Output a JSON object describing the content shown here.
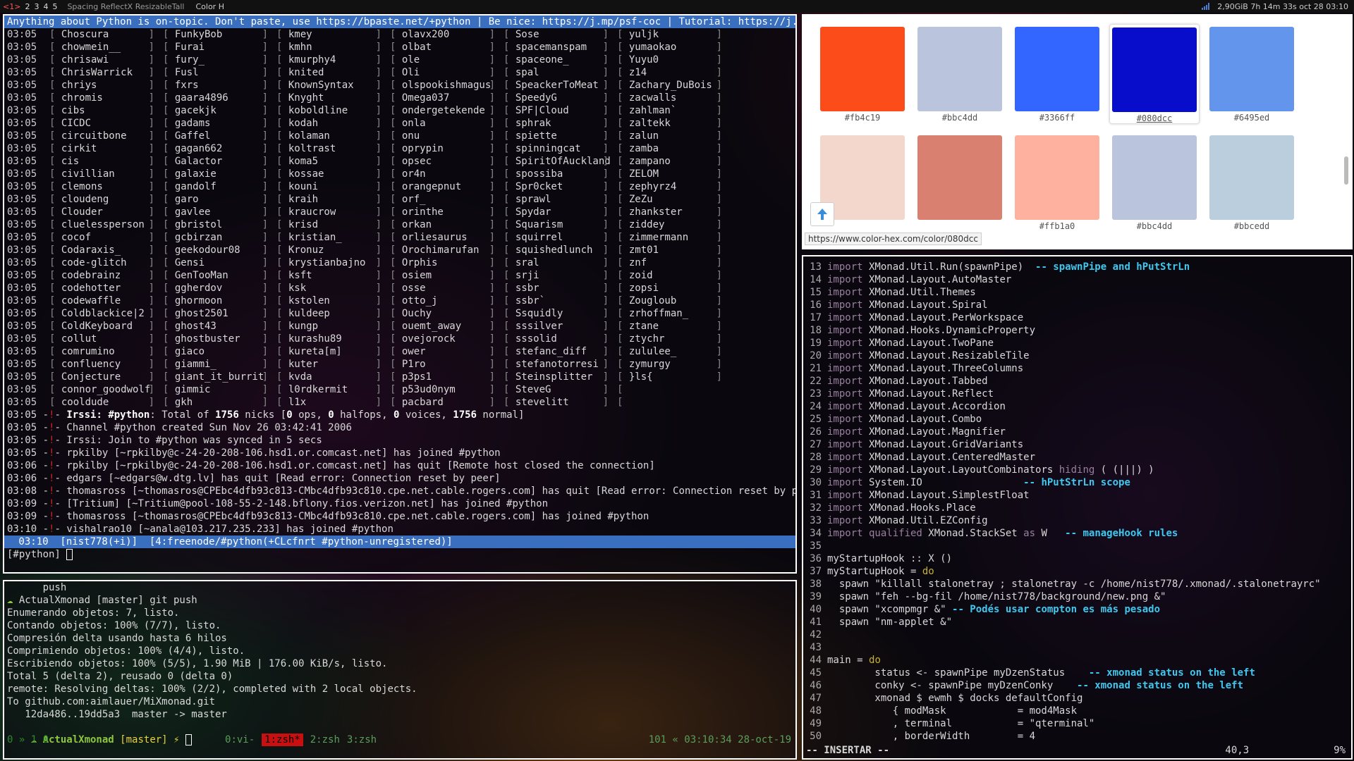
{
  "bar": {
    "workspaces": [
      "<1>",
      "2",
      "3",
      "4",
      "5"
    ],
    "layout": "Spacing ReflectX ResizableTall",
    "title": "Color H",
    "stats": "2,90GiB  7h 14m 33s oct 28 03:10"
  },
  "irssi": {
    "topic": "Anything about Python is on-topic. Don't paste, use https://bpaste.net/+python | Be nice: https://j.mp/psf-coc | Tutorial: https://j.mp/MC",
    "time": "03:05",
    "rows": [
      [
        "Choscura",
        "FunkyBob",
        "kmey",
        "olavx200",
        "Sose",
        "yuljk"
      ],
      [
        "chowmein__",
        "Furai",
        "kmhn",
        "olbat",
        "spacemanspam",
        "yumaokao"
      ],
      [
        "chrisawi",
        "fury_",
        "kmurphy4",
        "ole",
        "spaceone_",
        "Yuyu0"
      ],
      [
        "ChrisWarrick",
        "Fusl",
        "knited",
        "Oli",
        "spal",
        "z14"
      ],
      [
        "chriys",
        "fxrs",
        "KnownSyntax",
        "olspookishmagus",
        "SpeackerToMeat",
        "Zachary_DuBois"
      ],
      [
        "chromis",
        "gaara4896",
        "Knyght",
        "Omega037",
        "SpeedyG",
        "zacwalls"
      ],
      [
        "cibs",
        "gacekjk",
        "koboldline",
        "ondergetekende",
        "SPF|Cloud",
        "zahlman`"
      ],
      [
        "CICDC",
        "gadams",
        "kodah",
        "onla",
        "sphrak",
        "zaltekk"
      ],
      [
        "circuitbone",
        "Gaffel",
        "kolaman",
        "onu",
        "spiette",
        "zalun"
      ],
      [
        "cirkit",
        "gagan662",
        "koltrast",
        "oprypin",
        "spinningcat",
        "zamba"
      ],
      [
        "cis",
        "Galactor",
        "koma5",
        "opsec",
        "SpiritOfAuckland",
        "zampano"
      ],
      [
        "civillian",
        "galaxie",
        "kossae",
        "or4n",
        "spossiba",
        "ZELOM"
      ],
      [
        "clemons",
        "gandolf",
        "kouni",
        "orangepnut",
        "Spr0cket",
        "zephyrz4"
      ],
      [
        "cloudeng",
        "garo",
        "kraih",
        "orf_",
        "sprawl",
        "ZeZu"
      ],
      [
        "Clouder",
        "gavlee",
        "kraucrow",
        "orinthe",
        "Spydar",
        "zhankster"
      ],
      [
        "cluelessperson",
        "gbristol",
        "krisd",
        "orkan",
        "Squarism",
        "ziddey"
      ],
      [
        "cocof",
        "gcbirzan",
        "kristian_",
        "orliesaurus",
        "squirrel",
        "zimmermann"
      ],
      [
        "Codaraxis_",
        "geekodour08",
        "Kronuz",
        "Orochimarufan",
        "squishedlunch",
        "zmt01"
      ],
      [
        "code-glitch",
        "Gensi",
        "krystianbajno",
        "Orphis",
        "sral",
        "znf"
      ],
      [
        "codebrainz",
        "GenTooMan",
        "ksft",
        "osiem",
        "srji",
        "zoid"
      ],
      [
        "codehotter",
        "ggherdov",
        "ksk",
        "osse",
        "ssbr",
        "zopsi"
      ],
      [
        "codewaffle",
        "ghormoon",
        "kstolen",
        "otto_j",
        "ssbr`",
        "Zougloub"
      ],
      [
        "Coldblackice|2",
        "ghost2501",
        "kuldeep",
        "Ouchy",
        "Ssquidly",
        "zrhoffman_"
      ],
      [
        "ColdKeyboard",
        "ghost43",
        "kungp",
        "ouemt_away",
        "sssilver",
        "ztane"
      ],
      [
        "collut",
        "ghostbuster",
        "kurashu89",
        "ovejorock",
        "sssolid",
        "ztychr"
      ],
      [
        "comrumino",
        "giaco",
        "kureta[m]",
        "ower",
        "stefanc_diff",
        "zululee_"
      ],
      [
        "confluency",
        "giammi_",
        "kuter",
        "P1ro",
        "stefanotorresi",
        "zymurgy"
      ],
      [
        "Conjecture",
        "giant_it_burrit",
        "kvda",
        "p3ps1",
        "Steinsplitter",
        "}ls{"
      ],
      [
        "connor_goodwolf",
        "gimmic",
        "l0rdkermit",
        "p53ud0nym",
        "SteveG",
        ""
      ],
      [
        "cooldude",
        "gkh",
        "l1x",
        "pacbard",
        "stevelitt",
        ""
      ]
    ],
    "messages": [
      {
        "time": "03:05",
        "pre": "Irssi: ",
        "b1": "#python",
        "t1": ": Total of ",
        "b2": "1756",
        "t2": " nicks [",
        "b3": "0",
        "t3": " ops, ",
        "b4": "0",
        "t4": " halfops, ",
        "b5": "0",
        "t5": " voices, ",
        "b6": "1756",
        "t6": " normal]"
      },
      {
        "time": "03:05",
        "text": "Channel #python created Sun Nov 26 03:42:41 2006"
      },
      {
        "time": "03:05",
        "text": "Irssi: Join to #python was synced in 5 secs"
      },
      {
        "time": "03:05",
        "text": "rpkilby [~rpkilby@c-24-20-208-106.hsd1.or.comcast.net] has joined #python"
      },
      {
        "time": "03:06",
        "text": "rpkilby [~rpkilby@c-24-20-208-106.hsd1.or.comcast.net] has quit [Remote host closed the connection]"
      },
      {
        "time": "03:06",
        "text": "edgars [~edgars@w.dtg.lv] has quit [Read error: Connection reset by peer]"
      },
      {
        "time": "03:08",
        "text": "thomasross [~thomasros@CPEbc4dfb93c813-CMbc4dfb93c810.cpe.net.cable.rogers.com] has quit [Read error: Connection reset by peer]"
      },
      {
        "time": "03:09",
        "text": "[Tritium] [~Tritium@pool-108-55-2-148.bflony.fios.verizon.net] has joined #python"
      },
      {
        "time": "03:09",
        "text": "thomasross [~thomasros@CPEbc4dfb93c813-CMbc4dfb93c810.cpe.net.cable.rogers.com] has joined #python"
      },
      {
        "time": "03:10",
        "text": "vishalrao10 [~anala@103.217.235.233] has joined #python"
      }
    ],
    "status": " 03:10  [nist778(+i)]  [4:freenode/#python(+CLcfnrt #python-unregistered)]",
    "prompt": "[#python] "
  },
  "zsh": {
    "lines": [
      "      push",
      "ActualXmonad [master] git push",
      "Enumerando objetos: 7, listo.",
      "Contando objetos: 100% (7/7), listo.",
      "Compresión delta usando hasta 6 hilos",
      "Comprimiendo objetos: 100% (4/4), listo.",
      "Escribiendo objetos: 100% (5/5), 1.90 MiB | 176.00 KiB/s, listo.",
      "Total 5 (delta 2), reusado 0 (delta 0)",
      "remote: Resolving deltas: 100% (2/2), completed with 2 local objects.",
      "To github.com:aimlauer/MiXmonad.git",
      "   12da486..19dd5a3  master -> master"
    ],
    "prompt_dir": "ActualXmonad",
    "prompt_branch": "[master]",
    "prompt_sym": "⚡",
    "tmux_left": "0 » 1 0",
    "tabs": [
      "0:vi-",
      "1:zsh*",
      "2:zsh",
      "3:zsh"
    ],
    "tmux_right": "101 « 03:10:34 28-oct-19"
  },
  "colorhex": {
    "swatches": [
      {
        "hex": "#fb4c19",
        "color": "#fb4c19"
      },
      {
        "hex": "#bbc4dd",
        "color": "#bbc4dd"
      },
      {
        "hex": "#3366ff",
        "color": "#3366ff"
      },
      {
        "hex": "#080dcc",
        "color": "#080dcc",
        "selected": true
      },
      {
        "hex": "#6495ed",
        "color": "#6495ed"
      },
      {
        "hex": "",
        "color": "#f3d7cd"
      },
      {
        "hex": "",
        "color": "#d98070"
      },
      {
        "hex": "#ffb1a0",
        "color": "#ffb1a0"
      },
      {
        "hex": "#bbc4dd",
        "color": "#bbc4dd"
      },
      {
        "hex": "#bbcedd",
        "color": "#bbcedd"
      }
    ],
    "url": "https://www.color-hex.com/color/080dcc"
  },
  "vim": {
    "lines": [
      {
        "n": "13",
        "kw": "import",
        "code": " XMonad.Util.Run(spawnPipe)  ",
        "cm": "-- spawnPipe and hPutStrLn"
      },
      {
        "n": "14",
        "kw": "import",
        "code": " XMonad.Layout.AutoMaster"
      },
      {
        "n": "15",
        "kw": "import",
        "code": " XMonad.Util.Themes"
      },
      {
        "n": "16",
        "kw": "import",
        "code": " XMonad.Layout.Spiral"
      },
      {
        "n": "17",
        "kw": "import",
        "code": " XMonad.Layout.PerWorkspace"
      },
      {
        "n": "18",
        "kw": "import",
        "code": " XMonad.Hooks.DynamicProperty"
      },
      {
        "n": "19",
        "kw": "import",
        "code": " XMonad.Layout.TwoPane"
      },
      {
        "n": "20",
        "kw": "import",
        "code": " XMonad.Layout.ResizableTile"
      },
      {
        "n": "21",
        "kw": "import",
        "code": " XMonad.Layout.ThreeColumns"
      },
      {
        "n": "22",
        "kw": "import",
        "code": " XMonad.Layout.Tabbed"
      },
      {
        "n": "23",
        "kw": "import",
        "code": " XMonad.Layout.Reflect"
      },
      {
        "n": "24",
        "kw": "import",
        "code": " XMonad.Layout.Accordion"
      },
      {
        "n": "25",
        "kw": "import",
        "code": " XMonad.Layout.Combo"
      },
      {
        "n": "26",
        "kw": "import",
        "code": " XMonad.Layout.Magnifier"
      },
      {
        "n": "27",
        "kw": "import",
        "code": " XMonad.Layout.GridVariants"
      },
      {
        "n": "28",
        "kw": "import",
        "code": " XMonad.Layout.CenteredMaster"
      },
      {
        "n": "29",
        "kw": "import",
        "code": " XMonad.Layout.LayoutCombinators ",
        "kw3": "hiding",
        "tail": " ( (|||) )"
      },
      {
        "n": "30",
        "kw": "import",
        "code": " System.IO                 ",
        "cm": "-- hPutStrLn scope"
      },
      {
        "n": "31",
        "kw": "import",
        "code": " XMonad.Layout.SimplestFloat"
      },
      {
        "n": "32",
        "kw": "import",
        "code": " XMonad.Hooks.Place"
      },
      {
        "n": "33",
        "kw": "import",
        "code": " XMonad.Util.EZConfig"
      },
      {
        "n": "34",
        "kw": "import qualified",
        "code": " XMonad.StackSet ",
        "kw3": "as",
        "tail": " W   ",
        "cm": "-- manageHook rules"
      },
      {
        "n": "35",
        "code": ""
      },
      {
        "n": "36",
        "code": "myStartupHook :: X ()"
      },
      {
        "n": "37",
        "code": "myStartupHook = ",
        "kw2": "do"
      },
      {
        "n": "38",
        "code": "  spawn \"killall stalonetray ; stalonetray -c /home/nist778/.xmonad/.stalonetrayrc\""
      },
      {
        "n": "39",
        "code": "  spawn \"feh --bg-fil /home/nist778/background/new.png &\""
      },
      {
        "n": "40",
        "code": "  spawn \"xcompmgr &\" ",
        "cm": "-- Podés usar compton es más pesado"
      },
      {
        "n": "41",
        "code": "  spawn \"nm-applet &\""
      },
      {
        "n": "42",
        "code": ""
      },
      {
        "n": "43",
        "code": ""
      },
      {
        "n": "44",
        "code": "main = ",
        "kw2": "do"
      },
      {
        "n": "45",
        "code": "        status <- spawnPipe myDzenStatus    ",
        "cm": "-- xmonad status on the left"
      },
      {
        "n": "46",
        "code": "        conky <- spawnPipe myDzenConky    ",
        "cm": "-- xmonad status on the left"
      },
      {
        "n": "47",
        "code": "        xmonad $ ewmh $ docks defaultConfig"
      },
      {
        "n": "48",
        "code": "           { modMask            = mod4Mask"
      },
      {
        "n": "49",
        "code": "           , terminal           = \"qterminal\""
      },
      {
        "n": "50",
        "code": "           , borderWidth        = 4"
      }
    ],
    "mode": "-- INSERTAR --",
    "pos": "40,3",
    "pct": "9%"
  }
}
